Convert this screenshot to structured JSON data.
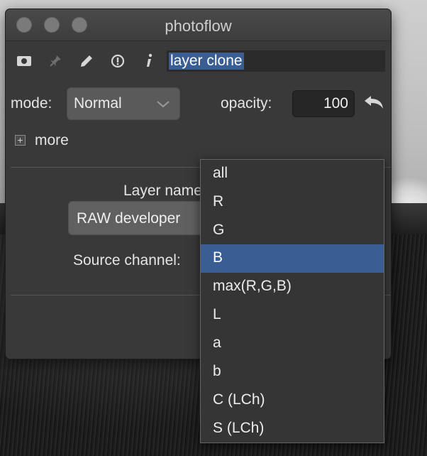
{
  "window": {
    "title": "photoflow"
  },
  "toolbar": {
    "icons": [
      "visibility-toggle-icon",
      "pin-icon",
      "edit-icon",
      "info-circle-icon",
      "info-icon"
    ],
    "layer_name_value": "layer clone"
  },
  "blend": {
    "mode_label": "mode:",
    "mode_value": "Normal",
    "opacity_label": "opacity:",
    "opacity_value": "100",
    "more_label": "more"
  },
  "clone": {
    "layer_name_label": "Layer name",
    "layer_button_label": "RAW developer",
    "source_channel_label": "Source channel:"
  },
  "channel_menu": {
    "selected": "B",
    "options": [
      "all",
      "R",
      "G",
      "B",
      "max(R,G,B)",
      "L",
      "a",
      "b",
      "C (LCh)",
      "S (LCh)"
    ]
  },
  "colors": {
    "selection": "#3a5e94",
    "panel": "#393939",
    "popup": "#353535"
  }
}
